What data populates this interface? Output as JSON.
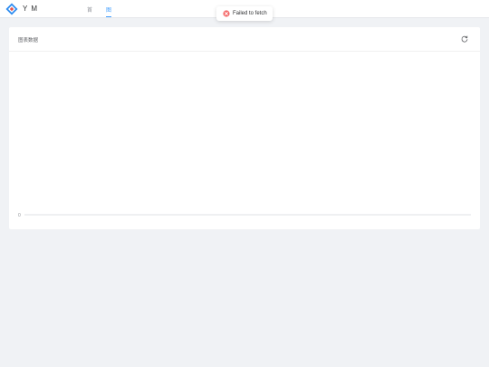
{
  "header": {
    "brand": "Y M",
    "nav": [
      {
        "label": "首",
        "active": false
      },
      {
        "label": "图",
        "active": true
      }
    ]
  },
  "toast": {
    "message": "Failed to fetch",
    "icon": "error-circle-icon",
    "color": "#f56c6c"
  },
  "card": {
    "title": "图表数据",
    "refresh_icon": "refresh-icon"
  },
  "chart_data": {
    "type": "line",
    "series": [],
    "ytick_labels": [
      "0"
    ],
    "ylim": [
      0,
      1
    ],
    "grid": false
  },
  "colors": {
    "accent": "#409eff",
    "error": "#f56c6c",
    "background": "#f0f2f5"
  }
}
